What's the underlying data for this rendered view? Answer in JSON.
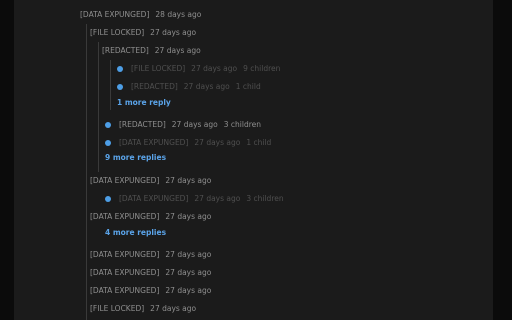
{
  "comments": [
    {
      "author": "[DATA EXPUNGED]",
      "age": "28 days ago"
    },
    {
      "author": "[FILE LOCKED]",
      "age": "27 days ago"
    },
    {
      "author": "[REDACTED]",
      "age": "27 days ago"
    },
    {
      "author": "[FILE LOCKED]",
      "age": "27 days ago",
      "children": "9 children"
    },
    {
      "author": "[REDACTED]",
      "age": "27 days ago",
      "children": "1 child"
    },
    {
      "author": "[REDACTED]",
      "age": "27 days ago",
      "children": "3 children"
    },
    {
      "author": "[DATA EXPUNGED]",
      "age": "27 days ago",
      "children": "1 child"
    },
    {
      "author": "[DATA EXPUNGED]",
      "age": "27 days ago"
    },
    {
      "author": "[DATA EXPUNGED]",
      "age": "27 days ago",
      "children": "3 children"
    },
    {
      "author": "[DATA EXPUNGED]",
      "age": "27 days ago"
    },
    {
      "author": "[DATA EXPUNGED]",
      "age": "27 days ago"
    },
    {
      "author": "[DATA EXPUNGED]",
      "age": "27 days ago"
    },
    {
      "author": "[DATA EXPUNGED]",
      "age": "27 days ago"
    },
    {
      "author": "[FILE LOCKED]",
      "age": "27 days ago"
    }
  ],
  "more_replies": [
    {
      "label": "1 more reply"
    },
    {
      "label": "9 more replies"
    },
    {
      "label": "4 more replies"
    }
  ],
  "icons": {
    "collapse": "expand-dot-icon"
  },
  "colors": {
    "accent": "#4d9ee6",
    "link": "#5aa3e8"
  }
}
